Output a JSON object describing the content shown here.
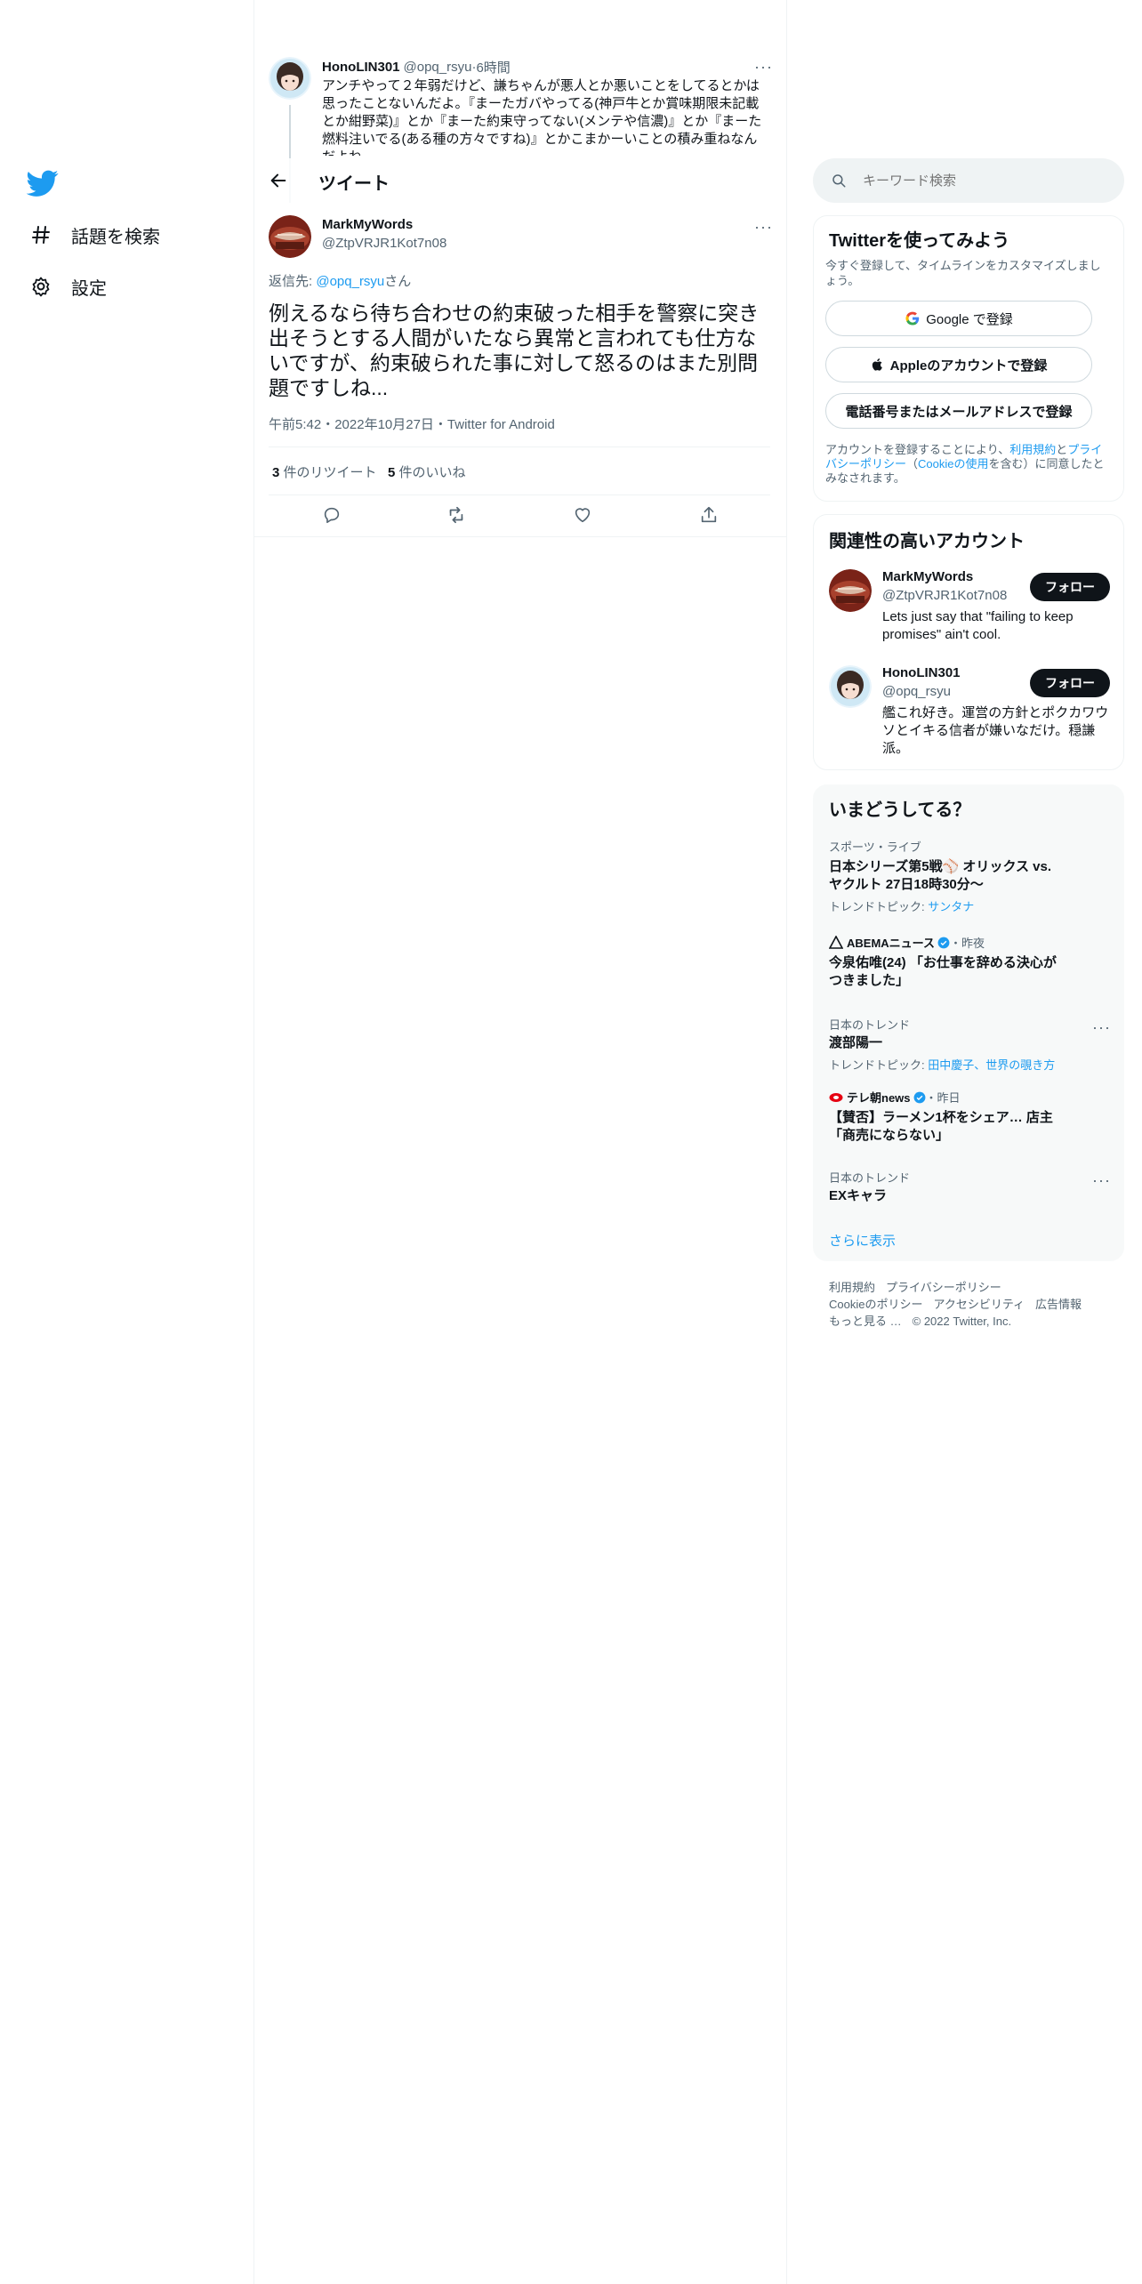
{
  "nav": {
    "items": [
      {
        "label": "話題を検索",
        "icon": "hashtag-icon"
      },
      {
        "label": "設定",
        "icon": "gear-icon"
      }
    ],
    "brand_color": "#1d9bf0"
  },
  "header": {
    "title": "ツイート"
  },
  "parent_tweet": {
    "name": "HonoLIN301",
    "handle": "@opq_rsyu",
    "time": "6時間",
    "text": "アンチやって２年弱だけど、謙ちゃんが悪人とか悪いことをしてるとかは思ったことないんだよ。『まーたガバやってる(神戸牛とか賞味期限未記載とか紺野菜)』とか『まーた約束守ってない(メンテや信濃)』とか『まーた燃料注いでる(ある種の方々ですね)』とかこまかーいことの積み重ねなんだよね"
  },
  "main_tweet": {
    "name": "MarkMyWords",
    "handle": "@ZtpVRJR1Kot7n08",
    "reply_prefix": "返信先: ",
    "reply_to": "@opq_rsyu",
    "reply_suffix": "さん",
    "text": "例えるなら待ち合わせの約束破った相手を警察に突き出そうとする人間がいたなら異常と言われても仕方ないですが、約束破られた事に対して怒るのはまた別問題ですしね...",
    "timestamp": "午前5:42・2022年10月27日・Twitter for Android",
    "retweets_count": "3",
    "retweets_label": " 件のリツイート",
    "likes_count": "5",
    "likes_label": " 件のいいね"
  },
  "search": {
    "placeholder": "キーワード検索"
  },
  "signup": {
    "title": "Twitterを使ってみよう",
    "subtitle": "今すぐ登録して、タイムラインをカスタマイズしましょう。",
    "google_label": "Google で登録",
    "apple_label": "Appleのアカウントで登録",
    "phone_label": "電話番号またはメールアドレスで登録",
    "terms_1": "アカウントを登録することにより、",
    "terms_link_1": "利用規約",
    "terms_2": "と",
    "terms_link_2": "プライバシーポリシー",
    "terms_3": "（",
    "terms_link_3": "Cookieの使用",
    "terms_4": "を含む）に同意したとみなされます。"
  },
  "relevant": {
    "title": "関連性の高いアカウント",
    "accounts": [
      {
        "name": "MarkMyWords",
        "handle": "@ZtpVRJR1Kot7n08",
        "bio": "Lets just say that \"failing to keep promises\" ain't cool.",
        "follow_label": "フォロー"
      },
      {
        "name": "HonoLIN301",
        "handle": "@opq_rsyu",
        "bio": "艦これ好き。運営の方針とポクカワウソとイキる信者が嫌いなだけ。穏謙派。",
        "follow_label": "フォロー"
      }
    ]
  },
  "trends": {
    "title": "いまどうしてる？",
    "items": [
      {
        "category": "スポーツ・ライブ",
        "title": "日本シリーズ第5戦⚾ オリックス vs. ヤクルト 27日18時30分〜",
        "sub_prefix": "トレンドトピック: ",
        "sub_link": "サンタナ"
      },
      {
        "source": "ABEMAニュース",
        "time": "・昨夜",
        "title": "今泉佑唯(24) 「お仕事を辞める決心がつきました」"
      },
      {
        "category": "日本のトレンド",
        "title": "渡部陽一",
        "sub_prefix": "トレンドトピック: ",
        "sub_link": "田中慶子、世界の覗き方"
      },
      {
        "source": "テレ朝news",
        "time": "・昨日",
        "title": "【賛否】ラーメン1杯をシェア… 店主「商売にならない」"
      },
      {
        "category": "日本のトレンド",
        "title": "EXキャラ"
      }
    ],
    "show_more": "さらに表示"
  },
  "footer": {
    "links": [
      "利用規約",
      "プライバシーポリシー",
      "Cookieのポリシー",
      "アクセシビリティ",
      "広告情報",
      "もっと見る …"
    ],
    "copyright": "© 2022 Twitter, Inc."
  }
}
